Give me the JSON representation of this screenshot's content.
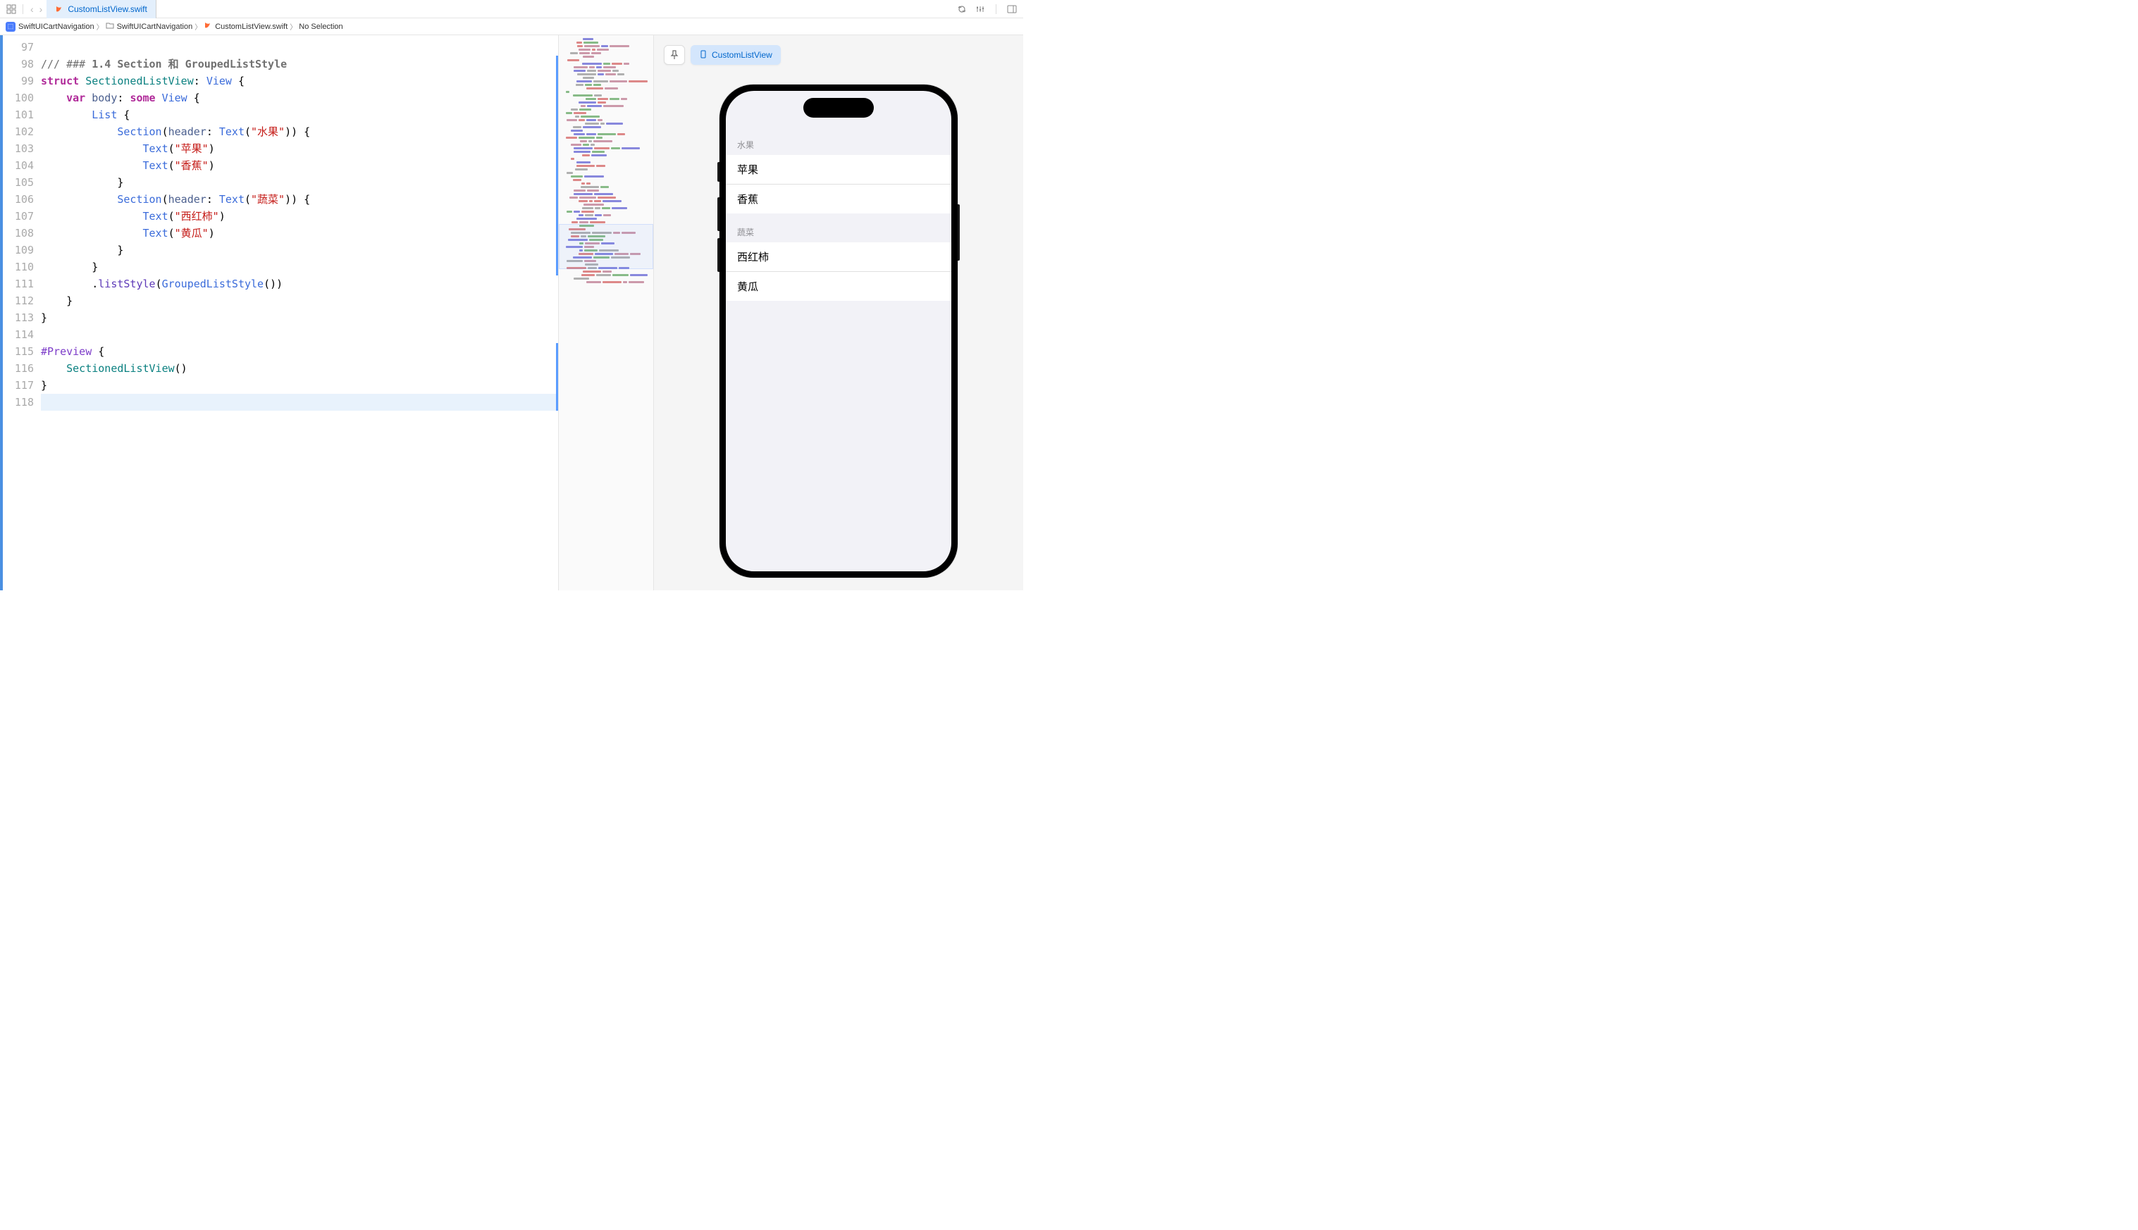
{
  "tab": {
    "filename": "CustomListView.swift"
  },
  "breadcrumb": {
    "project": "SwiftUICartNavigation",
    "folder": "SwiftUICartNavigation",
    "file": "CustomListView.swift",
    "selection": "No Selection"
  },
  "preview": {
    "label": "CustomListView"
  },
  "code": {
    "lines": [
      {
        "num": "97",
        "tokens": []
      },
      {
        "num": "98",
        "tokens": [
          {
            "t": "/// ### ",
            "c": "c-comment"
          },
          {
            "t": "1.4 Section 和 GroupedListStyle",
            "c": "c-comment c-bold"
          }
        ]
      },
      {
        "num": "99",
        "tokens": [
          {
            "t": "struct",
            "c": "c-keyword"
          },
          {
            "t": " ",
            "c": "c-plain"
          },
          {
            "t": "SectionedListView",
            "c": "c-typename"
          },
          {
            "t": ": ",
            "c": "c-plain"
          },
          {
            "t": "View",
            "c": "c-type"
          },
          {
            "t": " {",
            "c": "c-plain"
          }
        ]
      },
      {
        "num": "100",
        "tokens": [
          {
            "t": "    ",
            "c": "c-plain"
          },
          {
            "t": "var",
            "c": "c-keyword"
          },
          {
            "t": " ",
            "c": "c-plain"
          },
          {
            "t": "body",
            "c": "c-prop"
          },
          {
            "t": ": ",
            "c": "c-plain"
          },
          {
            "t": "some",
            "c": "c-keyword"
          },
          {
            "t": " ",
            "c": "c-plain"
          },
          {
            "t": "View",
            "c": "c-type"
          },
          {
            "t": " {",
            "c": "c-plain"
          }
        ]
      },
      {
        "num": "101",
        "tokens": [
          {
            "t": "        ",
            "c": "c-plain"
          },
          {
            "t": "List",
            "c": "c-type"
          },
          {
            "t": " {",
            "c": "c-plain"
          }
        ]
      },
      {
        "num": "102",
        "tokens": [
          {
            "t": "            ",
            "c": "c-plain"
          },
          {
            "t": "Section",
            "c": "c-type"
          },
          {
            "t": "(",
            "c": "c-plain"
          },
          {
            "t": "header",
            "c": "c-prop"
          },
          {
            "t": ": ",
            "c": "c-plain"
          },
          {
            "t": "Text",
            "c": "c-type"
          },
          {
            "t": "(",
            "c": "c-plain"
          },
          {
            "t": "\"水果\"",
            "c": "c-string"
          },
          {
            "t": ")) {",
            "c": "c-plain"
          }
        ]
      },
      {
        "num": "103",
        "tokens": [
          {
            "t": "                ",
            "c": "c-plain"
          },
          {
            "t": "Text",
            "c": "c-type"
          },
          {
            "t": "(",
            "c": "c-plain"
          },
          {
            "t": "\"苹果\"",
            "c": "c-string"
          },
          {
            "t": ")",
            "c": "c-plain"
          }
        ]
      },
      {
        "num": "104",
        "tokens": [
          {
            "t": "                ",
            "c": "c-plain"
          },
          {
            "t": "Text",
            "c": "c-type"
          },
          {
            "t": "(",
            "c": "c-plain"
          },
          {
            "t": "\"香蕉\"",
            "c": "c-string"
          },
          {
            "t": ")",
            "c": "c-plain"
          }
        ]
      },
      {
        "num": "105",
        "tokens": [
          {
            "t": "            }",
            "c": "c-plain"
          }
        ]
      },
      {
        "num": "106",
        "tokens": [
          {
            "t": "            ",
            "c": "c-plain"
          },
          {
            "t": "Section",
            "c": "c-type"
          },
          {
            "t": "(",
            "c": "c-plain"
          },
          {
            "t": "header",
            "c": "c-prop"
          },
          {
            "t": ": ",
            "c": "c-plain"
          },
          {
            "t": "Text",
            "c": "c-type"
          },
          {
            "t": "(",
            "c": "c-plain"
          },
          {
            "t": "\"蔬菜\"",
            "c": "c-string"
          },
          {
            "t": ")) {",
            "c": "c-plain"
          }
        ]
      },
      {
        "num": "107",
        "tokens": [
          {
            "t": "                ",
            "c": "c-plain"
          },
          {
            "t": "Text",
            "c": "c-type"
          },
          {
            "t": "(",
            "c": "c-plain"
          },
          {
            "t": "\"西红柿\"",
            "c": "c-string"
          },
          {
            "t": ")",
            "c": "c-plain"
          }
        ]
      },
      {
        "num": "108",
        "tokens": [
          {
            "t": "                ",
            "c": "c-plain"
          },
          {
            "t": "Text",
            "c": "c-type"
          },
          {
            "t": "(",
            "c": "c-plain"
          },
          {
            "t": "\"黄瓜\"",
            "c": "c-string"
          },
          {
            "t": ")",
            "c": "c-plain"
          }
        ]
      },
      {
        "num": "109",
        "tokens": [
          {
            "t": "            }",
            "c": "c-plain"
          }
        ]
      },
      {
        "num": "110",
        "tokens": [
          {
            "t": "        }",
            "c": "c-plain"
          }
        ]
      },
      {
        "num": "111",
        "tokens": [
          {
            "t": "        .",
            "c": "c-plain"
          },
          {
            "t": "listStyle",
            "c": "c-method"
          },
          {
            "t": "(",
            "c": "c-plain"
          },
          {
            "t": "GroupedListStyle",
            "c": "c-type"
          },
          {
            "t": "())",
            "c": "c-plain"
          }
        ]
      },
      {
        "num": "112",
        "tokens": [
          {
            "t": "    }",
            "c": "c-plain"
          }
        ]
      },
      {
        "num": "113",
        "tokens": [
          {
            "t": "}",
            "c": "c-plain"
          }
        ]
      },
      {
        "num": "114",
        "tokens": []
      },
      {
        "num": "115",
        "tokens": [
          {
            "t": "#Preview",
            "c": "c-preview"
          },
          {
            "t": " {",
            "c": "c-plain"
          }
        ]
      },
      {
        "num": "116",
        "tokens": [
          {
            "t": "    ",
            "c": "c-plain"
          },
          {
            "t": "SectionedListView",
            "c": "c-typename"
          },
          {
            "t": "()",
            "c": "c-plain"
          }
        ]
      },
      {
        "num": "117",
        "tokens": [
          {
            "t": "}",
            "c": "c-plain"
          }
        ]
      },
      {
        "num": "118",
        "tokens": [],
        "current": true
      }
    ]
  },
  "iphone": {
    "sections": [
      {
        "header": "水果",
        "rows": [
          "苹果",
          "香蕉"
        ]
      },
      {
        "header": "蔬菜",
        "rows": [
          "西红柿",
          "黄瓜"
        ]
      }
    ]
  }
}
